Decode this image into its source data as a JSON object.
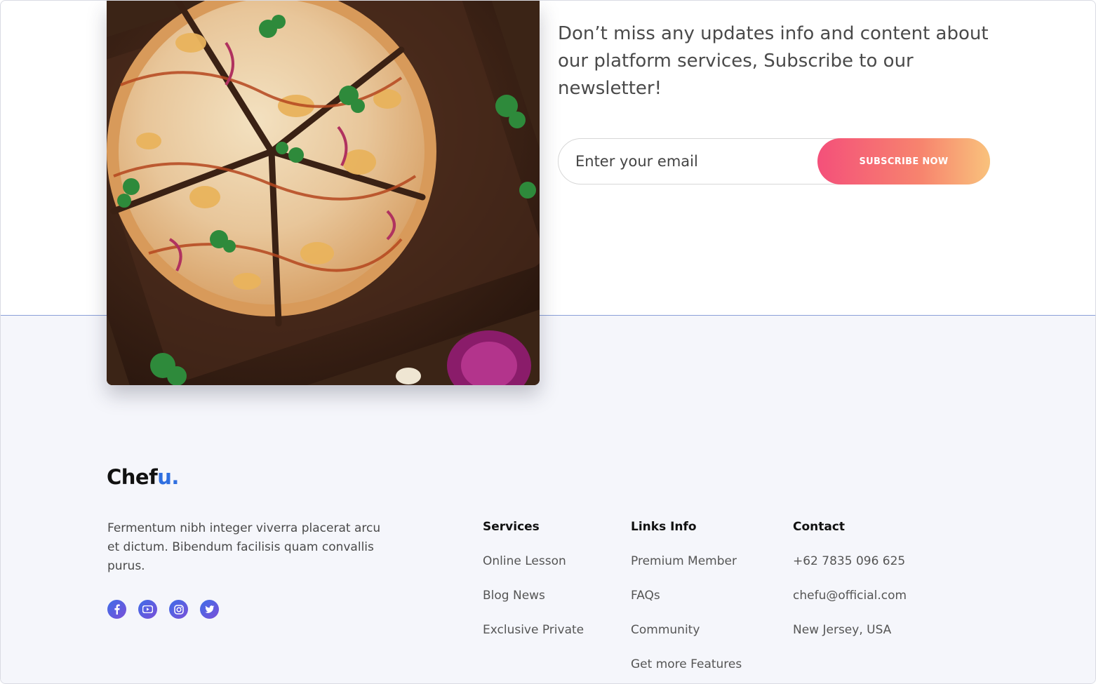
{
  "newsletter": {
    "text": "Don’t miss any updates info and content about our  platform services, Subscribe to our newsletter!",
    "email_placeholder": "Enter your email",
    "button_label": "SUBSCRIBE NOW"
  },
  "brand": {
    "name_main": "Chef",
    "name_accent": "u.",
    "accent_color": "#2f6fe0"
  },
  "about": "Fermentum nibh integer viverra placerat arcu et dictum. Bibendum facilisis quam convallis purus.",
  "socials": [
    {
      "icon": "facebook-icon"
    },
    {
      "icon": "youtube-icon"
    },
    {
      "icon": "instagram-icon"
    },
    {
      "icon": "twitter-icon"
    }
  ],
  "services": {
    "heading": "Services",
    "items": [
      "Online Lesson",
      "Blog News",
      "Exclusive Private"
    ]
  },
  "links": {
    "heading": "Links Info",
    "items": [
      "Premium Member",
      "FAQs",
      "Community",
      "Get more Features"
    ]
  },
  "contact": {
    "heading": "Contact",
    "items": [
      "+62 7835 096 625",
      "chefu@official.com",
      "New Jersey, USA"
    ]
  },
  "colors": {
    "button_gradient_start": "#f4507a",
    "button_gradient_end": "#f9c27c",
    "footer_bg": "#f5f6fb"
  }
}
